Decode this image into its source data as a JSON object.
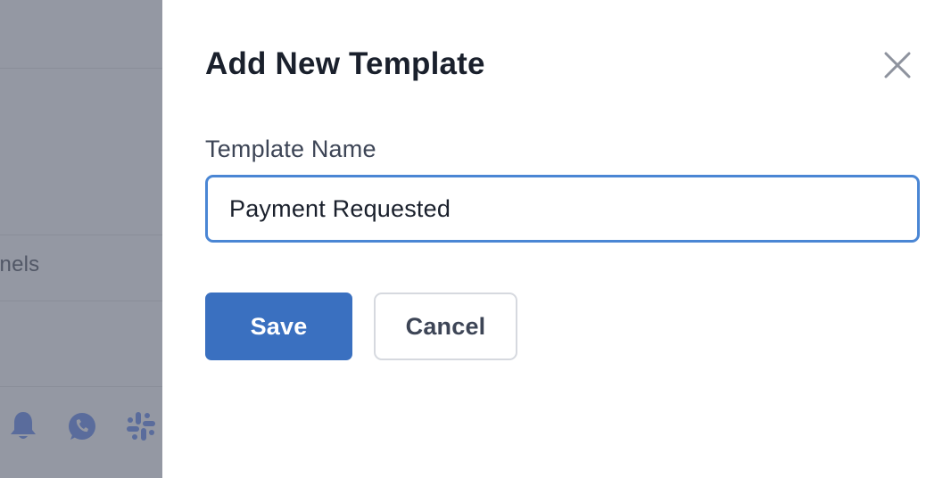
{
  "backdrop": {
    "partial_label": "nnels",
    "icons": [
      "bell-icon",
      "whatsapp-icon",
      "slack-icon"
    ]
  },
  "modal": {
    "title": "Add New Template",
    "close_icon": "close-icon",
    "field_label": "Template Name",
    "input_value": "Payment Requested",
    "save_label": "Save",
    "cancel_label": "Cancel"
  },
  "colors": {
    "overlay": "#9498a3",
    "primary": "#3a70c0",
    "focus_border": "#4a86d4",
    "title_text": "#1a202c",
    "label_text": "#3d4556",
    "backdrop_icon": "#5a6c9c"
  }
}
